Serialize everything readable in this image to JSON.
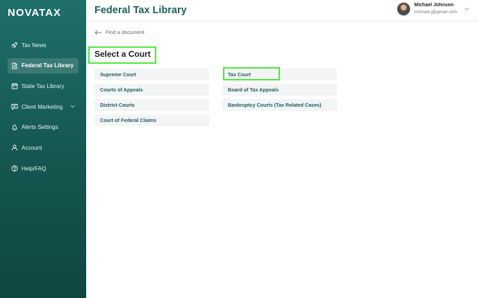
{
  "brand": {
    "logo_text": "NOVATAX"
  },
  "header": {
    "title": "Federal Tax Library",
    "user": {
      "name": "Michael Johnson",
      "email": "michael.j@gmail.com"
    }
  },
  "sidebar": {
    "items": [
      {
        "label": "Tax News",
        "icon": "rocket-icon",
        "active": false
      },
      {
        "label": "Federal Tax Library",
        "icon": "document-icon",
        "active": true
      },
      {
        "label": "State Tax Library",
        "icon": "calendar-icon",
        "active": false
      },
      {
        "label": "Client Marketing",
        "icon": "chat-icon",
        "active": false,
        "has_submenu": true
      },
      {
        "label": "Alerts Settings",
        "icon": "bell-icon",
        "active": false
      },
      {
        "label": "Account",
        "icon": "user-icon",
        "active": false
      },
      {
        "label": "Help/FAQ",
        "icon": "help-icon",
        "active": false
      }
    ]
  },
  "main": {
    "back_link": "Find a document",
    "section_title": "Select a Court",
    "courts_left": [
      "Supreme Court",
      "Courts of Appeals",
      "District Courts",
      "Court of Federal Claims"
    ],
    "courts_right": [
      "Tax Court",
      "Board of Tax Appeals",
      "Bankruptcy Courts (Tax Related Cases)"
    ]
  },
  "colors": {
    "sidebar_top": "#1f6f6a",
    "sidebar_bottom": "#0f4640",
    "accent_text": "#1b5f57",
    "highlight": "#4cea3c",
    "button_bg": "#f3f4f5"
  }
}
